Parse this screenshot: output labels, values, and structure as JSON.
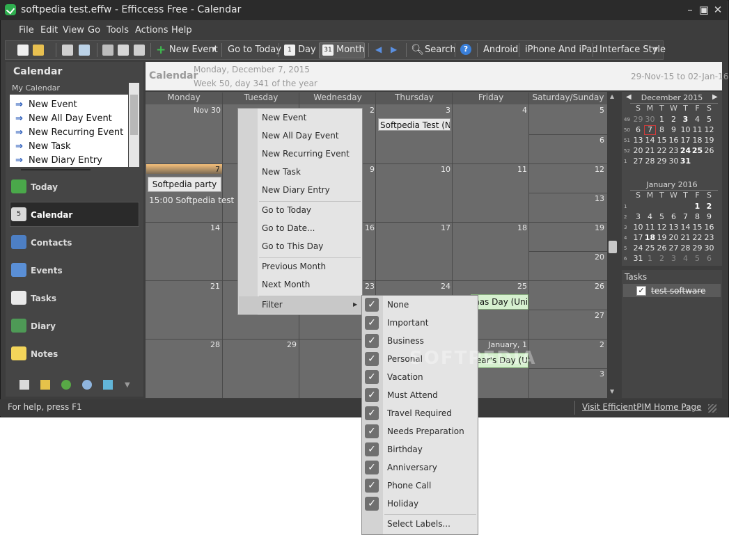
{
  "window": {
    "title": "softpedia test.effw - Efficcess Free - Calendar"
  },
  "menubar": [
    "File",
    "Edit",
    "View",
    "Go",
    "Tools",
    "Actions",
    "Help"
  ],
  "toolbar": {
    "new_event": "New Event",
    "go_to_today": "Go to Today",
    "day": "Day",
    "month": "Month",
    "search": "Search",
    "android": "Android",
    "iphone": "iPhone And iPad",
    "interface_style": "Interface Style"
  },
  "left": {
    "heading": "Calendar",
    "my_calendar": "My Calendar",
    "new_items": [
      "New Event",
      "New All Day Event",
      "New Recurring Event",
      "New Task",
      "New Diary Entry"
    ],
    "nav": [
      "Today",
      "Calendar",
      "Contacts",
      "Events",
      "Tasks",
      "Diary",
      "Notes"
    ]
  },
  "header": {
    "title": "Calendar",
    "date": "Monday, December 7, 2015",
    "week": "Week 50, day 341 of the year",
    "range": "29-Nov-15 to 02-Jan-16"
  },
  "grid": {
    "days": [
      "Monday",
      "Tuesday",
      "Wednesday",
      "Thursday",
      "Friday",
      "Saturday/Sunday"
    ],
    "weeks": [
      {
        "mon": "Nov 30",
        "tue": "",
        "wed": "2",
        "thu": "3",
        "fri": "4",
        "sat": "5",
        "sun": "6"
      },
      {
        "mon": "7",
        "tue": "",
        "wed": "9",
        "thu": "10",
        "fri": "11",
        "sat": "12",
        "sun": "13"
      },
      {
        "mon": "14",
        "tue": "",
        "wed": "16",
        "thu": "17",
        "fri": "18",
        "sat": "19",
        "sun": "20"
      },
      {
        "mon": "21",
        "tue": "",
        "wed": "23",
        "thu": "24",
        "fri": "25",
        "sat": "26",
        "sun": "27"
      },
      {
        "mon": "28",
        "tue": "29",
        "wed": "",
        "thu": "",
        "fri": "January, 1",
        "sat": "2",
        "sun": "3"
      }
    ],
    "events": {
      "thu3": "Softpedia Test (NYC",
      "mon7a": "Softpedia party",
      "mon7b": "15:00 Softpedia test",
      "fri25": "mas Day (Unite",
      "fri1": "ear's Day (Uni"
    }
  },
  "mini": {
    "dec_title": "December 2015",
    "jan_title": "January 2016",
    "dow": [
      "S",
      "M",
      "T",
      "W",
      "T",
      "F",
      "S"
    ],
    "dec_weeks": [
      "49",
      "50",
      "51",
      "52",
      "1"
    ],
    "dec_rows": [
      [
        "29",
        "30",
        "1",
        "2",
        "3",
        "4",
        "5"
      ],
      [
        "6",
        "7",
        "8",
        "9",
        "10",
        "11",
        "12"
      ],
      [
        "13",
        "14",
        "15",
        "16",
        "17",
        "18",
        "19"
      ],
      [
        "20",
        "21",
        "22",
        "23",
        "24",
        "25",
        "26"
      ],
      [
        "27",
        "28",
        "29",
        "30",
        "31",
        "",
        ""
      ]
    ],
    "jan_weeks": [
      "1",
      "2",
      "3",
      "4",
      "5",
      "6"
    ],
    "jan_rows": [
      [
        "",
        "",
        "",
        "",
        "",
        "1",
        "2"
      ],
      [
        "3",
        "4",
        "5",
        "6",
        "7",
        "8",
        "9"
      ],
      [
        "10",
        "11",
        "12",
        "13",
        "14",
        "15",
        "16"
      ],
      [
        "17",
        "18",
        "19",
        "20",
        "21",
        "22",
        "23"
      ],
      [
        "24",
        "25",
        "26",
        "27",
        "28",
        "29",
        "30"
      ],
      [
        "31",
        "1",
        "2",
        "3",
        "4",
        "5",
        "6"
      ]
    ]
  },
  "tasks": {
    "title": "Tasks",
    "items": [
      "test software"
    ]
  },
  "status": {
    "help": "For help, press F1",
    "link": "Visit EfficientPIM Home Page"
  },
  "context_menu": {
    "items": [
      "New Event",
      "New All Day Event",
      "New Recurring Event",
      "New Task",
      "New Diary Entry",
      "Go to Today",
      "Go to Date...",
      "Go to This Day",
      "Previous Month",
      "Next Month",
      "Filter"
    ]
  },
  "filter_menu": {
    "items": [
      "None",
      "Important",
      "Business",
      "Personal",
      "Vacation",
      "Must Attend",
      "Travel Required",
      "Needs Preparation",
      "Birthday",
      "Anniversary",
      "Phone Call",
      "Holiday"
    ],
    "select_labels": "Select Labels..."
  },
  "watermark": "SOFTPEDIA"
}
